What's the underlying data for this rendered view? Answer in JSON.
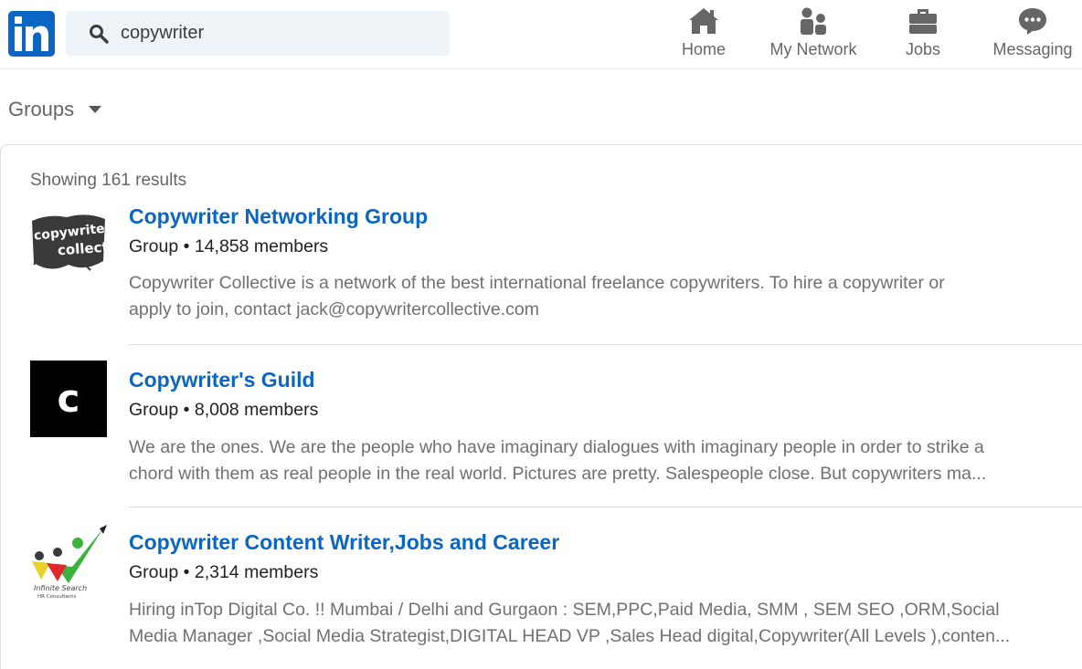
{
  "nav": {
    "logo_text": "in",
    "search_value": "copywriter",
    "items": [
      {
        "label": "Home",
        "icon": "home-icon"
      },
      {
        "label": "My Network",
        "icon": "network-icon"
      },
      {
        "label": "Jobs",
        "icon": "briefcase-icon"
      },
      {
        "label": "Messaging",
        "icon": "chat-icon"
      }
    ]
  },
  "filter": {
    "label": "Groups"
  },
  "results": {
    "summary": "Showing 161 results",
    "items": [
      {
        "title": "Copywriter Networking Group",
        "meta": "Group • 14,858 members",
        "desc_line1": "Copywriter Collective is a network of the best international freelance copywriters. To hire a copywriter or",
        "desc_line2": "apply to join, contact jack@copywritercollective.com",
        "logo_text_1": "copywriter",
        "logo_text_2": "collective"
      },
      {
        "title": "Copywriter's Guild",
        "meta": "Group • 8,008 members",
        "desc_line1": "We are the ones. We are the people who have imaginary dialogues with imaginary people in order to strike a",
        "desc_line2": "chord with them as real people in the real world. Pictures are pretty. Salespeople close. But copywriters ma...",
        "logo_text_1": "c"
      },
      {
        "title": "Copywriter Content Writer,Jobs and Career",
        "meta": "Group • 2,314 members",
        "desc_line1": "Hiring inTop Digital Co. !! Mumbai / Delhi and Gurgaon : SEM,PPC,Paid Media, SMM , SEM SEO ,ORM,Social",
        "desc_line2": "Media Manager ,Social Media Strategist,DIGITAL HEAD VP ,Sales Head digital,Copywriter(All Levels ),conten...",
        "logo_text_1": "Infinite Search",
        "logo_text_2": "HR Consultants"
      }
    ]
  },
  "colors": {
    "brand": "#0a66c2",
    "search_bg": "#eef3f8",
    "muted_text": "#666666",
    "desc_text": "#707070"
  }
}
